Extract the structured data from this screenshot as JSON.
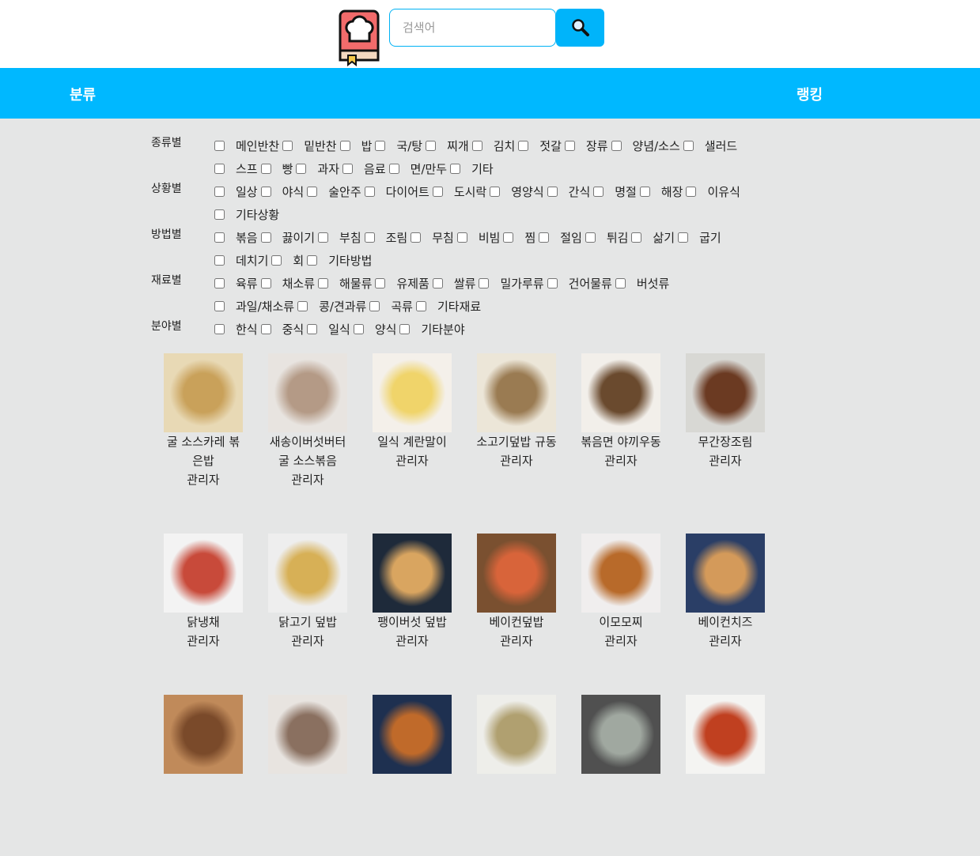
{
  "header": {
    "logo": "recipe-book-chef-hat-logo",
    "search_placeholder": "검색어",
    "search_value": "",
    "search_icon": "magnifier-icon"
  },
  "nav": {
    "category": "분류",
    "ranking": "랭킹"
  },
  "colors": {
    "accent": "#00b8ff",
    "background": "#e5e6e6"
  },
  "filters": [
    {
      "label": "종류별",
      "options": [
        "메인반찬",
        "밑반찬",
        "밥",
        "국/탕",
        "찌개",
        "김치",
        "젓갈",
        "장류",
        "양념/소스",
        "샐러드",
        "스프",
        "빵",
        "과자",
        "음료",
        "면/만두",
        "기타"
      ]
    },
    {
      "label": "상황별",
      "options": [
        "일상",
        "야식",
        "술안주",
        "다이어트",
        "도시락",
        "영양식",
        "간식",
        "명절",
        "해장",
        "이유식",
        "기타상황"
      ]
    },
    {
      "label": "방법별",
      "options": [
        "볶음",
        "끓이기",
        "부침",
        "조림",
        "무침",
        "비빔",
        "찜",
        "절임",
        "튀김",
        "삶기",
        "굽기",
        "데치기",
        "회",
        "기타방법"
      ]
    },
    {
      "label": "재료별",
      "options": [
        "육류",
        "채소류",
        "해물류",
        "유제품",
        "쌀류",
        "밀가루류",
        "건어물류",
        "버섯류",
        "과일/채소류",
        "콩/견과류",
        "곡류",
        "기타재료"
      ]
    },
    {
      "label": "분야별",
      "options": [
        "한식",
        "중식",
        "일식",
        "양식",
        "기타분야"
      ]
    }
  ],
  "recipes": [
    {
      "title": "굴 소스카레 볶은밥",
      "author": "관리자",
      "colors": [
        "#c9a15a",
        "#e8d9b5"
      ]
    },
    {
      "title": "새송이버섯버터굴 소스볶음",
      "author": "관리자",
      "colors": [
        "#b49a86",
        "#e8e4e0"
      ]
    },
    {
      "title": "일식 계란말이",
      "author": "관리자",
      "colors": [
        "#f0d46a",
        "#f4f0ea"
      ]
    },
    {
      "title": "소고기덮밥 규동",
      "author": "관리자",
      "colors": [
        "#9a7b52",
        "#ece6d8"
      ]
    },
    {
      "title": "볶음면 야끼우동",
      "author": "관리자",
      "colors": [
        "#6a4a2e",
        "#f2efea"
      ]
    },
    {
      "title": "무간장조림",
      "author": "관리자",
      "colors": [
        "#6b3a22",
        "#d8d8d4"
      ]
    },
    {
      "title": "닭냉채",
      "author": "관리자",
      "colors": [
        "#c84a3a",
        "#f3f3f3"
      ]
    },
    {
      "title": "닭고기 덮밥",
      "author": "관리자",
      "colors": [
        "#d7b056",
        "#eeeeee"
      ]
    },
    {
      "title": "팽이버섯 덮밥",
      "author": "관리자",
      "colors": [
        "#d9a560",
        "#1e2a3a"
      ]
    },
    {
      "title": "베이컨덮밥",
      "author": "관리자",
      "colors": [
        "#d8643a",
        "#7a5030"
      ]
    },
    {
      "title": "이모모찌",
      "author": "관리자",
      "colors": [
        "#b86a2a",
        "#f0eeee"
      ]
    },
    {
      "title": "베이컨치즈",
      "author": "관리자",
      "colors": [
        "#d49a5a",
        "#2a3e66"
      ]
    },
    {
      "colors": [
        "#7a4a2a",
        "#c08a5a"
      ]
    },
    {
      "colors": [
        "#8a7060",
        "#e8e4e0"
      ]
    },
    {
      "colors": [
        "#c06a2a",
        "#1e3050"
      ]
    },
    {
      "colors": [
        "#b0a070",
        "#eeeeea"
      ]
    },
    {
      "colors": [
        "#a0a8a0",
        "#505050"
      ]
    },
    {
      "colors": [
        "#c04020",
        "#f4f4f2"
      ]
    }
  ]
}
